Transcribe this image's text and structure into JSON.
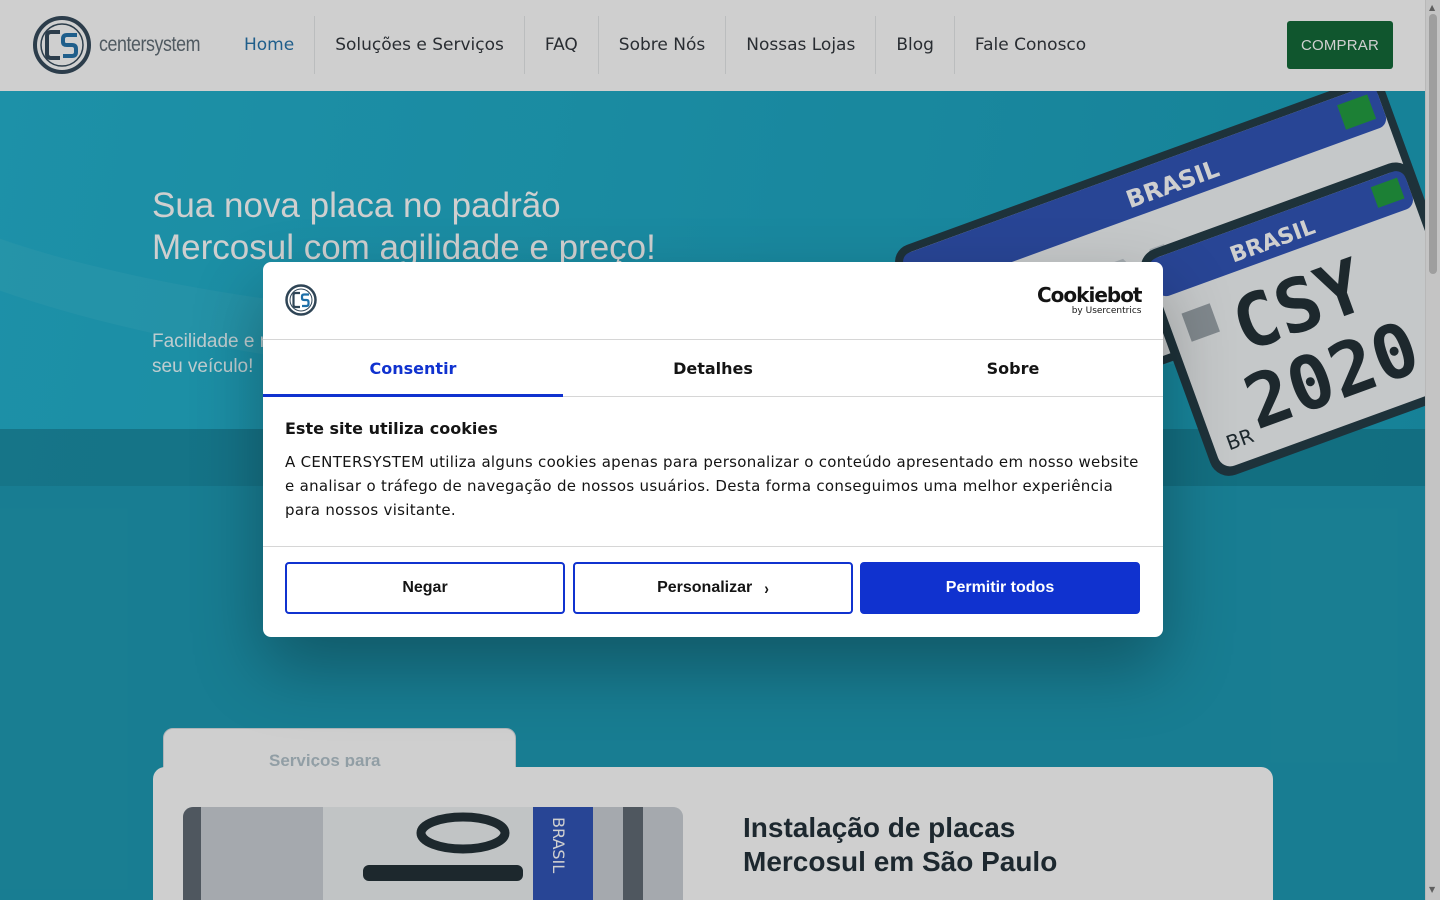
{
  "header": {
    "logo_text": "centersystem",
    "nav": [
      {
        "label": "Home",
        "active": true
      },
      {
        "label": "Soluções e Serviços",
        "active": false
      },
      {
        "label": "FAQ",
        "active": false
      },
      {
        "label": "Sobre Nós",
        "active": false
      },
      {
        "label": "Nossas Lojas",
        "active": false
      },
      {
        "label": "Blog",
        "active": false
      },
      {
        "label": "Fale Conosco",
        "active": false
      }
    ],
    "buy_label": "COMPRAR"
  },
  "hero": {
    "title": "Sua nova placa no padrão Mercosul com agilidade e preço!",
    "subtitle": "Facilidade e rapidez na entrega e instalação da nova placa do seu veículo!",
    "plate_country": "BRASIL",
    "plate_text_line1": "CSY",
    "plate_text_line2": "2020",
    "plate_br": "BR"
  },
  "services": {
    "tab_label": "Serviços para",
    "card_title": "Instalação de placas Mercosul em São Paulo",
    "image_plate_text": "BRASIL"
  },
  "cookie_dialog": {
    "brand_name": "Cookiebot",
    "brand_by": "by Usercentrics",
    "tabs": [
      {
        "label": "Consentir",
        "active": true
      },
      {
        "label": "Detalhes",
        "active": false
      },
      {
        "label": "Sobre",
        "active": false
      }
    ],
    "heading": "Este site utiliza cookies",
    "text": "A CENTERSYSTEM utiliza alguns cookies apenas para personalizar o conteúdo apresentado em nosso website e analisar o tráfego de navegação de nossos usuários. Desta forma conseguimos uma melhor experiência para nossos visitante.",
    "buttons": {
      "deny": "Negar",
      "customize": "Personalizar",
      "allow_all": "Permitir todos"
    }
  },
  "colors": {
    "brand_primary": "#1e6fa8",
    "buy_button": "#0b6431",
    "hero_bg": "#18a7c4",
    "dialog_accent": "#1032cf"
  },
  "icons": {
    "logo": "cs-logo-icon",
    "chevron": "chevron-right-icon"
  }
}
